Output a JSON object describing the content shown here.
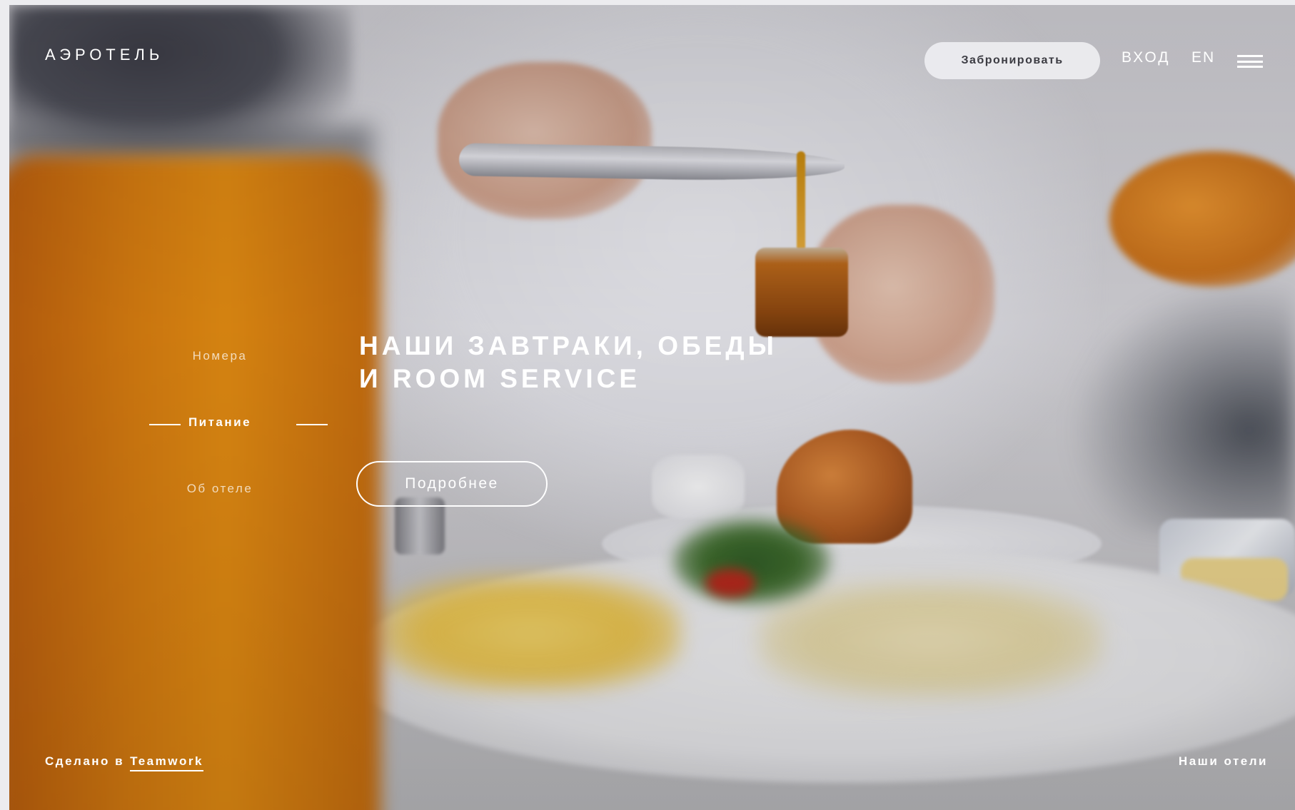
{
  "header": {
    "logo_text": "АЭРОТЕЛЬ",
    "book_label": "Забронировать",
    "login_label": "ВХОД",
    "lang_label": "EN",
    "menu_icon": "hamburger-menu-icon"
  },
  "side_nav": {
    "items": [
      {
        "label": "Номера",
        "active": false
      },
      {
        "label": "Питание",
        "active": true
      },
      {
        "label": "Об отеле",
        "active": false
      }
    ]
  },
  "hero": {
    "headline_line1": "НАШИ ЗАВТРАКИ, ОБЕДЫ",
    "headline_line2": "И ROOM SERVICE",
    "more_label": "Подробнее"
  },
  "footer": {
    "made_by_prefix": "Сделано в",
    "made_by_link": "Teamwork",
    "our_hotels_label": "Наши отели"
  },
  "colors": {
    "text": "#ffffff",
    "book_button_bg": "#eeeef1",
    "book_button_text": "#3b3b42"
  }
}
